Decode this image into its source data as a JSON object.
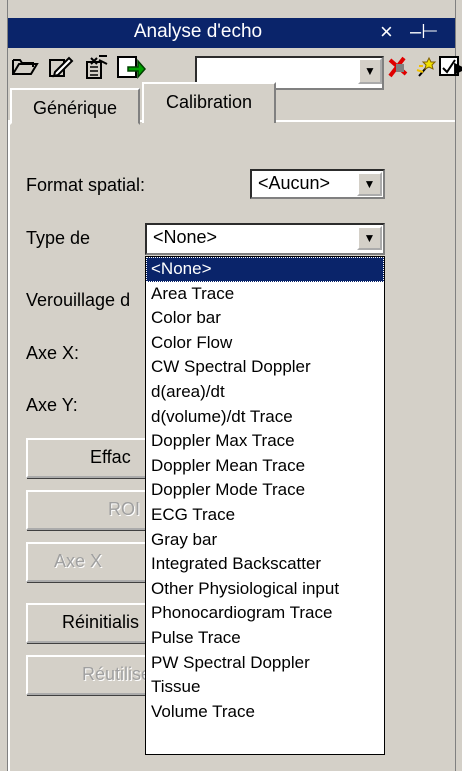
{
  "window": {
    "title": "Analyse d'echo",
    "close_glyph": "×",
    "pin_glyph": "–⊢"
  },
  "toolbar": {
    "icons": [
      "open-folder",
      "edit-pencil",
      "delete",
      "export"
    ],
    "combo_value": "",
    "right_icons": [
      "red-x",
      "wizard",
      "checkbox"
    ],
    "overflow_glyph": "▶"
  },
  "tabs": [
    {
      "label": "Générique",
      "active": false
    },
    {
      "label": "Calibration",
      "active": true
    }
  ],
  "form": {
    "format_spatial_label": "Format spatial:",
    "format_spatial_value": "<Aucun>",
    "type_de_label": "Type de",
    "type_de_value": "<None>",
    "verouillage_label": "Verouillage d",
    "axe_x_label": "Axe X:",
    "axe_y_label": "Axe Y:"
  },
  "buttons": {
    "effacer": "Effac",
    "roi": "ROI",
    "axe_x": "Axe X",
    "reinitialiser": "Réinitialis",
    "reutiliser": "Réutilise"
  },
  "dropdown": {
    "items": [
      "<None>",
      "Area Trace",
      "Color bar",
      "Color Flow",
      "CW Spectral Doppler",
      "d(area)/dt",
      "d(volume)/dt Trace",
      "Doppler Max Trace",
      "Doppler Mean Trace",
      "Doppler Mode Trace",
      "ECG Trace",
      "Gray bar",
      "Integrated Backscatter",
      "Other Physiological input",
      "Phonocardiogram Trace",
      "Pulse Trace",
      "PW Spectral Doppler",
      "Tissue",
      "Volume Trace"
    ],
    "selected_index": 0
  }
}
